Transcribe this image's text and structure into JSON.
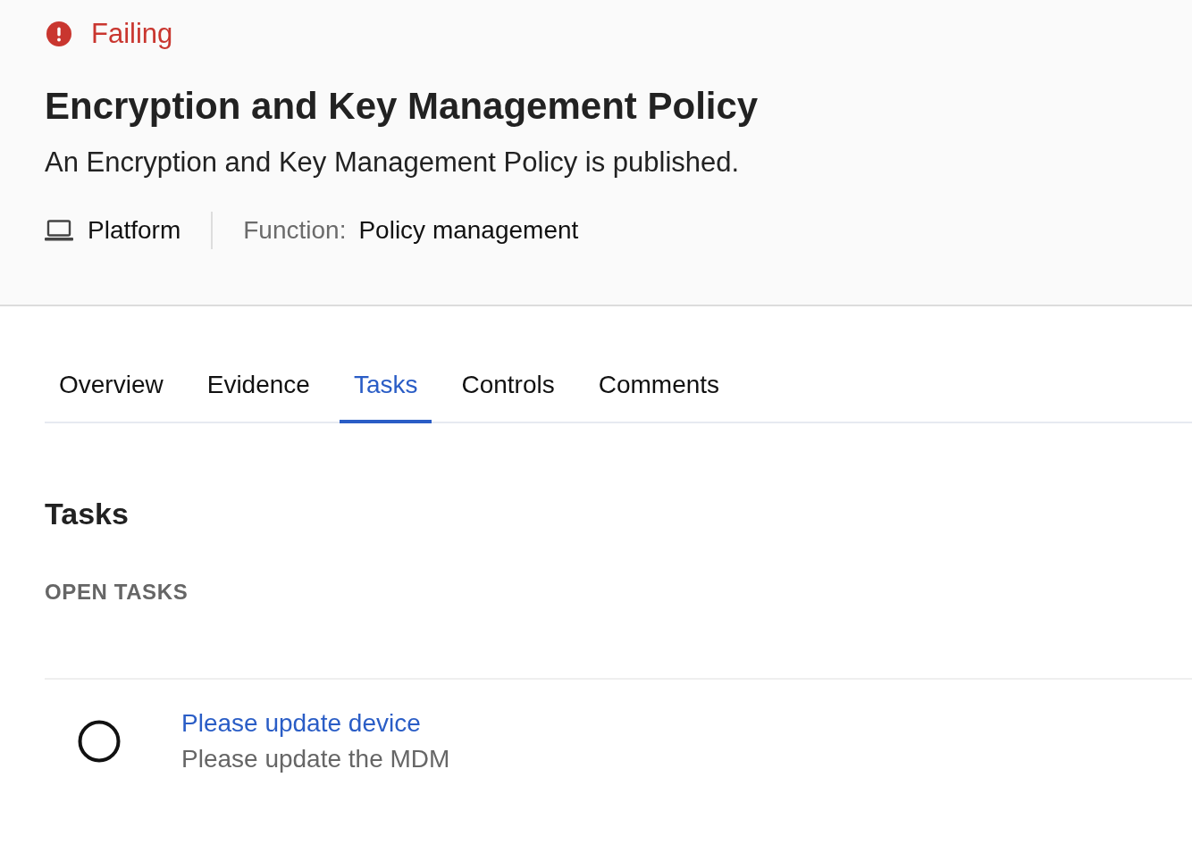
{
  "status": {
    "kind": "failing",
    "label": "Failing"
  },
  "policy": {
    "title": "Encryption and Key Management Policy",
    "description": "An Encryption and Key Management Policy is published."
  },
  "meta": {
    "platform": "Platform",
    "function_label": "Function:",
    "function_value": "Policy management"
  },
  "tabs": [
    {
      "label": "Overview",
      "selected": false
    },
    {
      "label": "Evidence",
      "selected": false
    },
    {
      "label": "Tasks",
      "selected": true
    },
    {
      "label": "Controls",
      "selected": false
    },
    {
      "label": "Comments",
      "selected": false
    }
  ],
  "section": {
    "title": "Tasks",
    "group_label": "OPEN TASKS"
  },
  "tasks": [
    {
      "title": "Please update device",
      "description": "Please update the MDM",
      "completed": false
    }
  ]
}
